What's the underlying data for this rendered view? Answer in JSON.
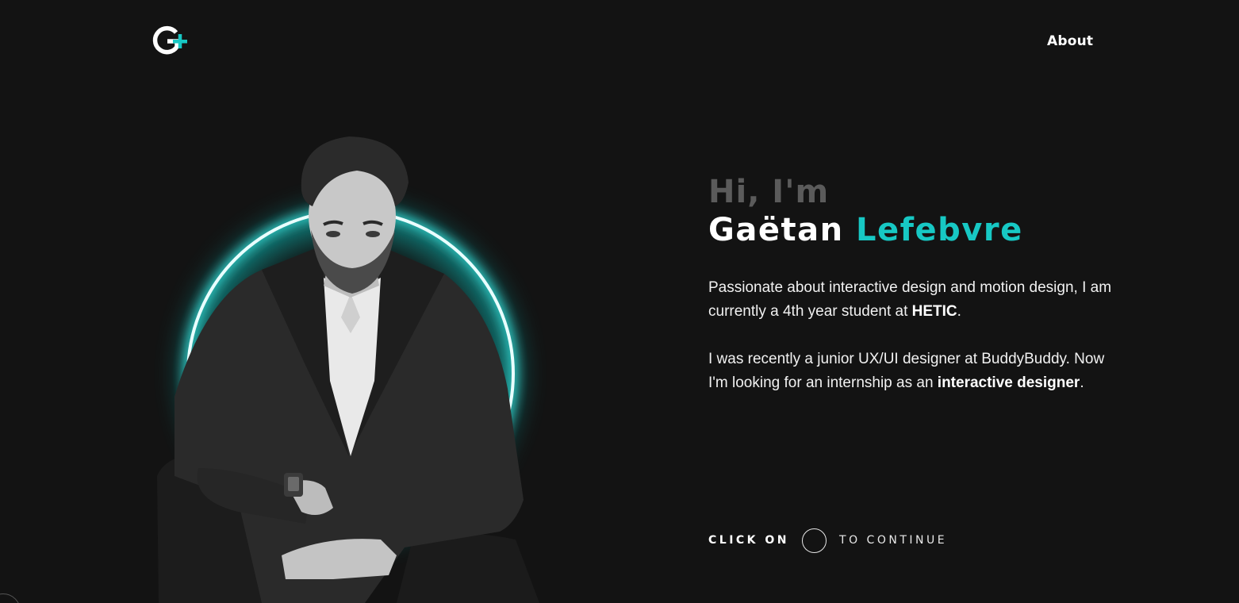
{
  "header": {
    "logo_alt": "G+",
    "nav": {
      "about_label": "About"
    }
  },
  "intro": {
    "greeting": "Hi, I'm",
    "first_name": "Gaëtan",
    "last_name": "Lefebvre",
    "bio": [
      {
        "before": "Passionate about interactive design and motion design, I am currently a 4th year student at ",
        "strong": "HETIC",
        "after": "."
      },
      {
        "before": "I was recently a junior UX/UI designer at BuddyBuddy. Now I'm looking for an internship as an ",
        "strong": "interactive designer",
        "after": "."
      }
    ]
  },
  "cta": {
    "left": "CLICK ON",
    "right": "TO CONTINUE"
  },
  "colors": {
    "background": "#131313",
    "accent": "#17c8c4",
    "greeting": "#5b5b5b"
  }
}
